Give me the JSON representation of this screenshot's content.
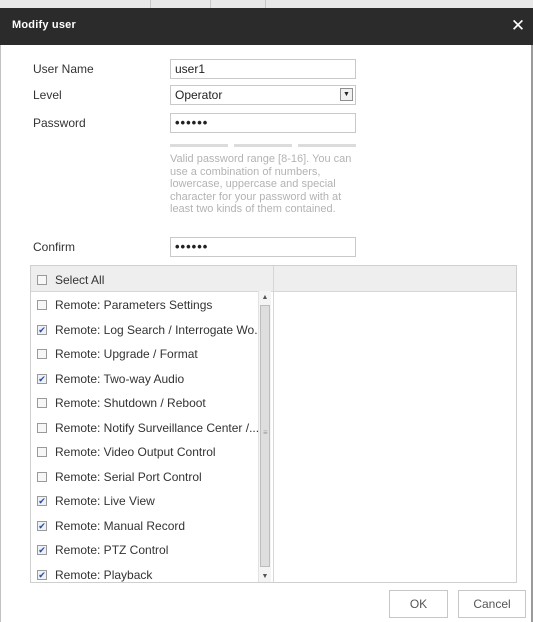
{
  "dialog": {
    "title": "Modify user",
    "close_glyph": "✕"
  },
  "form": {
    "username_label": "User Name",
    "username_value": "user1",
    "level_label": "Level",
    "level_value": "Operator",
    "password_label": "Password",
    "password_value": "••••••",
    "password_hint": "Valid password range [8-16]. You can use a combination of numbers, lowercase, uppercase and special character for your password with at least two kinds of them contained.",
    "confirm_label": "Confirm",
    "confirm_value": "••••••"
  },
  "permissions": {
    "select_all_label": "Select All",
    "select_all_checked": false,
    "items": [
      {
        "label": "Remote: Parameters Settings",
        "checked": false
      },
      {
        "label": "Remote: Log Search / Interrogate Wo...",
        "checked": true
      },
      {
        "label": "Remote: Upgrade / Format",
        "checked": false
      },
      {
        "label": "Remote: Two-way Audio",
        "checked": true
      },
      {
        "label": "Remote: Shutdown / Reboot",
        "checked": false
      },
      {
        "label": "Remote: Notify Surveillance Center /...",
        "checked": false
      },
      {
        "label": "Remote: Video Output Control",
        "checked": false
      },
      {
        "label": "Remote: Serial Port Control",
        "checked": false
      },
      {
        "label": "Remote: Live View",
        "checked": true
      },
      {
        "label": "Remote: Manual Record",
        "checked": true
      },
      {
        "label": "Remote: PTZ Control",
        "checked": true
      },
      {
        "label": "Remote: Playback",
        "checked": true
      }
    ]
  },
  "buttons": {
    "ok_label": "OK",
    "cancel_label": "Cancel"
  },
  "colors": {
    "titlebar": "#2b2b2b",
    "checkmark": "#2a4b9a",
    "hint_text": "#b3b3b3"
  }
}
